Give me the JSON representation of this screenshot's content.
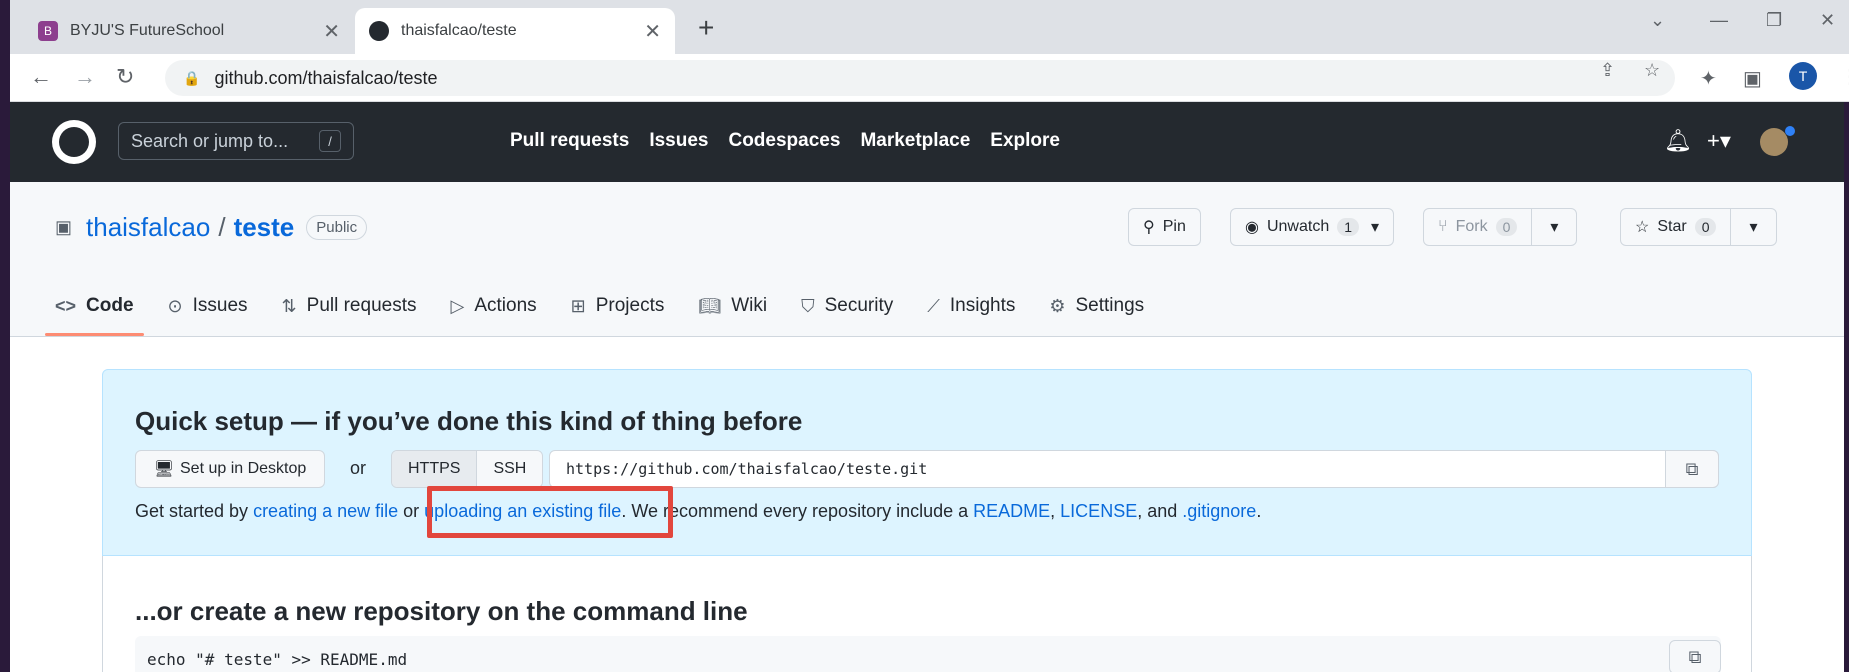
{
  "browser": {
    "tabs": [
      {
        "title": "BYJU'S FutureSchool",
        "favicon_color": "#8d3f8e",
        "active": false
      },
      {
        "title": "thaisfalcao/teste",
        "favicon_color": "#24292f",
        "active": true
      }
    ],
    "close_glyph": "✕",
    "newtab_glyph": "+",
    "url": "github.com/thaisfalcao/teste",
    "profile_initial": "T"
  },
  "gh_header": {
    "search_placeholder": "Search or jump to...",
    "search_shortcut": "/",
    "nav": [
      "Pull requests",
      "Issues",
      "Codespaces",
      "Marketplace",
      "Explore"
    ]
  },
  "repo": {
    "owner": "thaisfalcao",
    "separator": "/",
    "name": "teste",
    "visibility": "Public",
    "pin_label": "Pin",
    "watch_label": "Unwatch",
    "watch_count": "1",
    "fork_label": "Fork",
    "fork_count": "0",
    "star_label": "Star",
    "star_count": "0",
    "tabs": [
      {
        "label": "Code",
        "icon": "code-icon",
        "selected": true
      },
      {
        "label": "Issues",
        "icon": "issue-icon"
      },
      {
        "label": "Pull requests",
        "icon": "pull-request-icon"
      },
      {
        "label": "Actions",
        "icon": "play-icon"
      },
      {
        "label": "Projects",
        "icon": "table-icon"
      },
      {
        "label": "Wiki",
        "icon": "book-icon"
      },
      {
        "label": "Security",
        "icon": "shield-icon"
      },
      {
        "label": "Insights",
        "icon": "graph-icon"
      },
      {
        "label": "Settings",
        "icon": "gear-icon"
      }
    ]
  },
  "quick_setup": {
    "title": "Quick setup — if you’ve done this kind of thing before",
    "desktop_button": "Set up in Desktop",
    "or_text": "or",
    "protocols": [
      "HTTPS",
      "SSH"
    ],
    "selected_protocol": "HTTPS",
    "clone_url": "https://github.com/thaisfalcao/teste.git",
    "get_started_prefix": "Get started by ",
    "create_link": "creating a new file",
    "or_word": " or ",
    "upload_link": "uploading an existing file",
    "recommend_text": ". We recommend every repository include a ",
    "readme_link": "README",
    "comma": ", ",
    "license_link": "LICENSE",
    "and_text": ", and ",
    "gitignore_link": ".gitignore",
    "period": "."
  },
  "command_line": {
    "title": "...or create a new repository on the command line",
    "first_line": "echo \"# teste\" >> README.md"
  },
  "colors": {
    "highlight": "#e2463d",
    "link": "#0969da",
    "header_bg": "#24292f"
  }
}
